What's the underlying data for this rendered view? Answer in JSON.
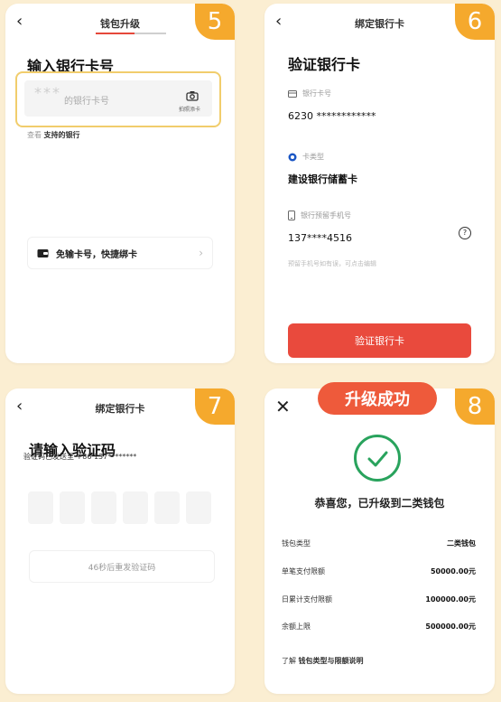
{
  "colors": {
    "accent": "#e94a3d",
    "badge": "#f5a92d",
    "success": "#29a35d",
    "background": "#fbeed2"
  },
  "panel5": {
    "step": "5",
    "title": "钱包升级",
    "heading": "输入银行卡号",
    "card_mask": "***",
    "card_placeholder": "的银行卡号",
    "camera_label": "拍照添卡",
    "supported_prefix": "查看",
    "supported_link": "支持的银行",
    "quick_bind": "免输卡号，快捷绑卡"
  },
  "panel6": {
    "step": "6",
    "title": "绑定银行卡",
    "heading": "验证银行卡",
    "card_no_label": "银行卡号",
    "card_no": "6230 ************",
    "card_type_label": "卡类型",
    "card_type": "建设银行储蓄卡",
    "phone_label": "银行预留手机号",
    "phone": "137****4516",
    "phone_hint": "预留手机号如有误，可点击编辑",
    "verify_button": "验证银行卡"
  },
  "panel7": {
    "step": "7",
    "title": "绑定银行卡",
    "heading": "请输入验证码",
    "sent_to": "验证码已发送至 +86 137********",
    "resend": "46秒后重发验证码"
  },
  "panel8": {
    "step": "8",
    "success_tag": "升级成功",
    "congrats": "恭喜您，已升级到二类钱包",
    "rows": [
      {
        "label": "钱包类型",
        "value": "二类钱包"
      },
      {
        "label": "单笔支付限额",
        "value": "50000.00元"
      },
      {
        "label": "日累计支付限额",
        "value": "100000.00元"
      },
      {
        "label": "余额上限",
        "value": "500000.00元"
      }
    ],
    "explain_prefix": "了解",
    "explain_link": "钱包类型与限额说明"
  }
}
